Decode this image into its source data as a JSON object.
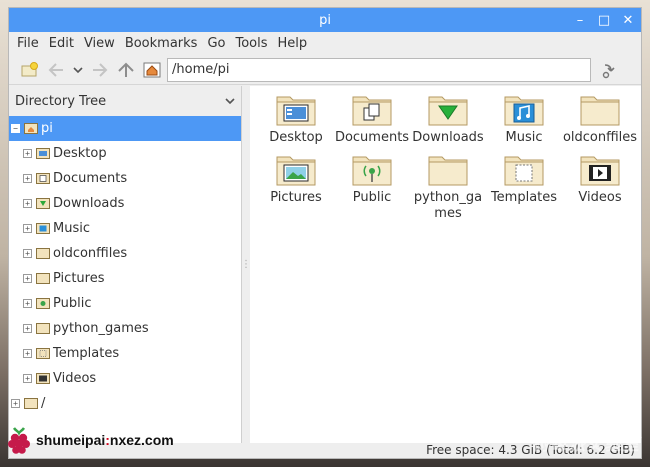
{
  "window": {
    "title": "pi"
  },
  "menu": [
    "File",
    "Edit",
    "View",
    "Bookmarks",
    "Go",
    "Tools",
    "Help"
  ],
  "toolbar": {
    "path": "/home/pi"
  },
  "sidebar": {
    "header": "Directory Tree",
    "root": "pi",
    "items": [
      {
        "label": "Desktop",
        "icon": "desktop-folder-icon"
      },
      {
        "label": "Documents",
        "icon": "documents-folder-icon"
      },
      {
        "label": "Downloads",
        "icon": "downloads-folder-icon"
      },
      {
        "label": "Music",
        "icon": "music-folder-icon"
      },
      {
        "label": "oldconffiles",
        "icon": "folder-icon"
      },
      {
        "label": "Pictures",
        "icon": "folder-icon"
      },
      {
        "label": "Public",
        "icon": "public-folder-icon"
      },
      {
        "label": "python_games",
        "icon": "folder-icon"
      },
      {
        "label": "Templates",
        "icon": "templates-folder-icon"
      },
      {
        "label": "Videos",
        "icon": "videos-folder-icon"
      }
    ],
    "filesystem_root": "/"
  },
  "files": [
    {
      "label": "Desktop",
      "kind": "desktop"
    },
    {
      "label": "Documents",
      "kind": "documents"
    },
    {
      "label": "Downloads",
      "kind": "downloads"
    },
    {
      "label": "Music",
      "kind": "music"
    },
    {
      "label": "oldconffiles",
      "kind": "plain"
    },
    {
      "label": "Pictures",
      "kind": "pictures"
    },
    {
      "label": "Public",
      "kind": "public"
    },
    {
      "label": "python_games",
      "kind": "plain"
    },
    {
      "label": "Templates",
      "kind": "templates"
    },
    {
      "label": "Videos",
      "kind": "videos"
    }
  ],
  "status": {
    "text": "Free space: 4.3 GiB (Total: 6.2 GiB)"
  },
  "watermark": {
    "left_a": "shumeipai",
    "left_colon": ":",
    "left_b": "nxez.com",
    "right": "树莓派实验室"
  },
  "colors": {
    "accent": "#4d98f5",
    "folder": "#f2e3bd",
    "folder_edge": "#b49a63"
  }
}
